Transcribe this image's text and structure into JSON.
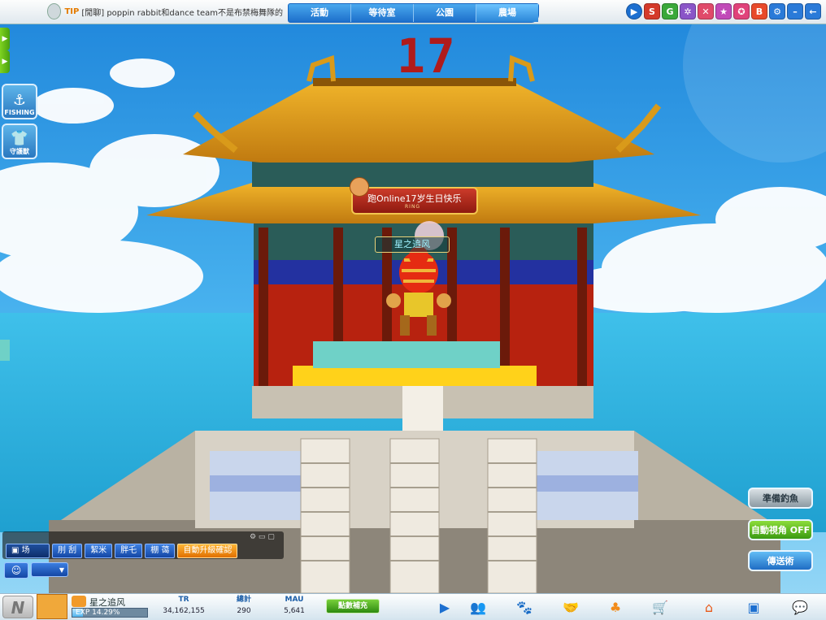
{
  "tip": {
    "prefix": "TIP",
    "text": "[閒聊] poppin rabbit和dance team不是布禁梅舞隊的"
  },
  "nav": {
    "tabs": [
      {
        "label": "活動"
      },
      {
        "label": "等待室"
      },
      {
        "label": "公園"
      },
      {
        "label": "農場"
      }
    ]
  },
  "top_buttons": {
    "icons": [
      "play-icon",
      "store-icon",
      "g-icon",
      "settings-icon",
      "x-icon",
      "star-icon",
      "star-book-icon",
      "book-icon",
      "gear-icon",
      "minimize-icon",
      "back-icon"
    ],
    "store_label": "S",
    "g_label": "G",
    "book_label": "B"
  },
  "left": {
    "fishing_label": "FISHING",
    "guard_label": "守護獸"
  },
  "scene": {
    "sign": "17",
    "event_title": "跑Online17岁生日快乐",
    "event_sub": "RING",
    "player_name": "星之追风"
  },
  "chat": {
    "tabs": [
      "场",
      "刖 刮",
      "絜米",
      "胖乇",
      "棚 蔼",
      "自動升級確認"
    ]
  },
  "actions": {
    "prepare_fishing": "準備釣魚",
    "auto_view": "自動視角 OFF",
    "teleport": "傳送術"
  },
  "status": {
    "player_name": "星之追风",
    "exp_label": "EXP 14.29%",
    "exp_percent": 14.29,
    "stats": [
      {
        "key": "TR",
        "value": "34,162,155"
      },
      {
        "key": "總計",
        "value": "290"
      },
      {
        "key": "MAU",
        "value": "5,641"
      }
    ],
    "topup_label": "點數補充"
  },
  "colors": {
    "nav_blue": "#1d6fcb",
    "roof_gold": "#e3a117",
    "pillar_red": "#b7220f",
    "sky_blue": "#2f9fe6"
  }
}
